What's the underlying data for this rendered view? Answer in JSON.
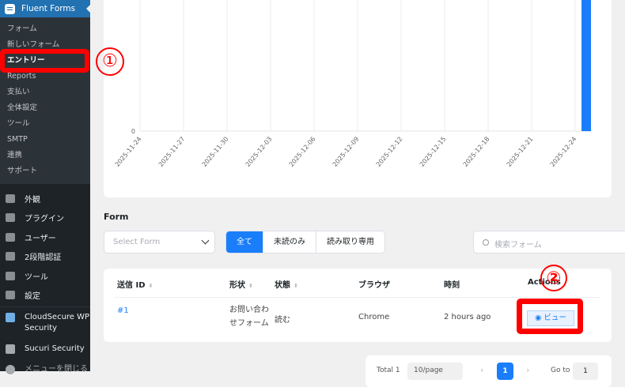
{
  "sidebar": {
    "plugin": "Fluent Forms",
    "sub": [
      "フォーム",
      "新しいフォーム",
      "エントリー",
      "Reports",
      "支払い",
      "全体設定",
      "ツール",
      "SMTP",
      "連携",
      "サポート"
    ],
    "menu": [
      "外観",
      "プラグイン",
      "ユーザー",
      "2段階認証",
      "ツール",
      "設定"
    ],
    "cloudsecure": "CloudSecure WP Security",
    "sucuri": "Sucuri Security",
    "collapse": "メニューを閉じる"
  },
  "chart_data": {
    "type": "bar",
    "x": [
      "2025-11-24",
      "2025-11-27",
      "2025-11-30",
      "2025-12-03",
      "2025-12-06",
      "2025-12-09",
      "2025-12-12",
      "2025-12-15",
      "2025-12-18",
      "2025-12-21",
      "2025-12-24"
    ],
    "y_tick": "0",
    "bar_at": "2025-12-24",
    "bar_color": "#1a7efb",
    "grid": true
  },
  "filters": {
    "label": "Form",
    "select_placeholder": "Select Form",
    "tabs": [
      "全て",
      "未読のみ",
      "読み取り専用"
    ],
    "search_placeholder": "検索フォーム"
  },
  "table": {
    "headers": [
      "送信 ID",
      "形状",
      "状態",
      "ブラウザ",
      "時刻",
      "Actions"
    ],
    "rows": [
      {
        "id": "#1",
        "form": "お問い合わせフォーム",
        "status": "読む",
        "browser": "Chrome",
        "time": "2 hours ago",
        "action": "ビュー"
      }
    ]
  },
  "pagination": {
    "total": "Total 1",
    "per_page": "10/page",
    "page": "1",
    "goto": "Go to",
    "goto_value": "1"
  },
  "annotations": [
    "①",
    "②"
  ]
}
